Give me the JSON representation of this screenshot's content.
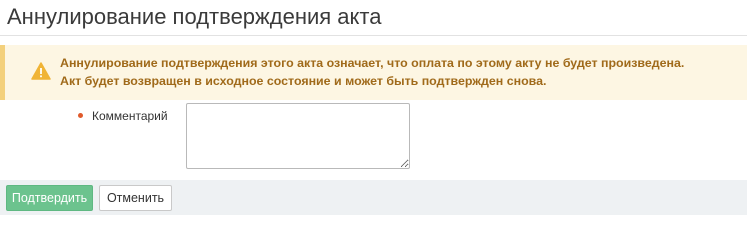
{
  "page": {
    "title": "Аннулирование подтверждения акта"
  },
  "alert": {
    "icon": "warning-icon",
    "line1": "Аннулирование подтверждения этого акта означает, что оплата по этому акту не будет произведена.",
    "line2": "Акт будет возвращен в исходное состояние и может быть подтвержден снова.",
    "background_color": "#fdf6e3",
    "accent_color": "#f3d07c",
    "text_color": "#a06a1a"
  },
  "form": {
    "comment_label": "Комментарий",
    "comment_value": "",
    "required_marker_color": "#e05a2b"
  },
  "footer": {
    "confirm_label": "Подтвердить",
    "cancel_label": "Отменить",
    "confirm_color": "#6cc38e"
  }
}
